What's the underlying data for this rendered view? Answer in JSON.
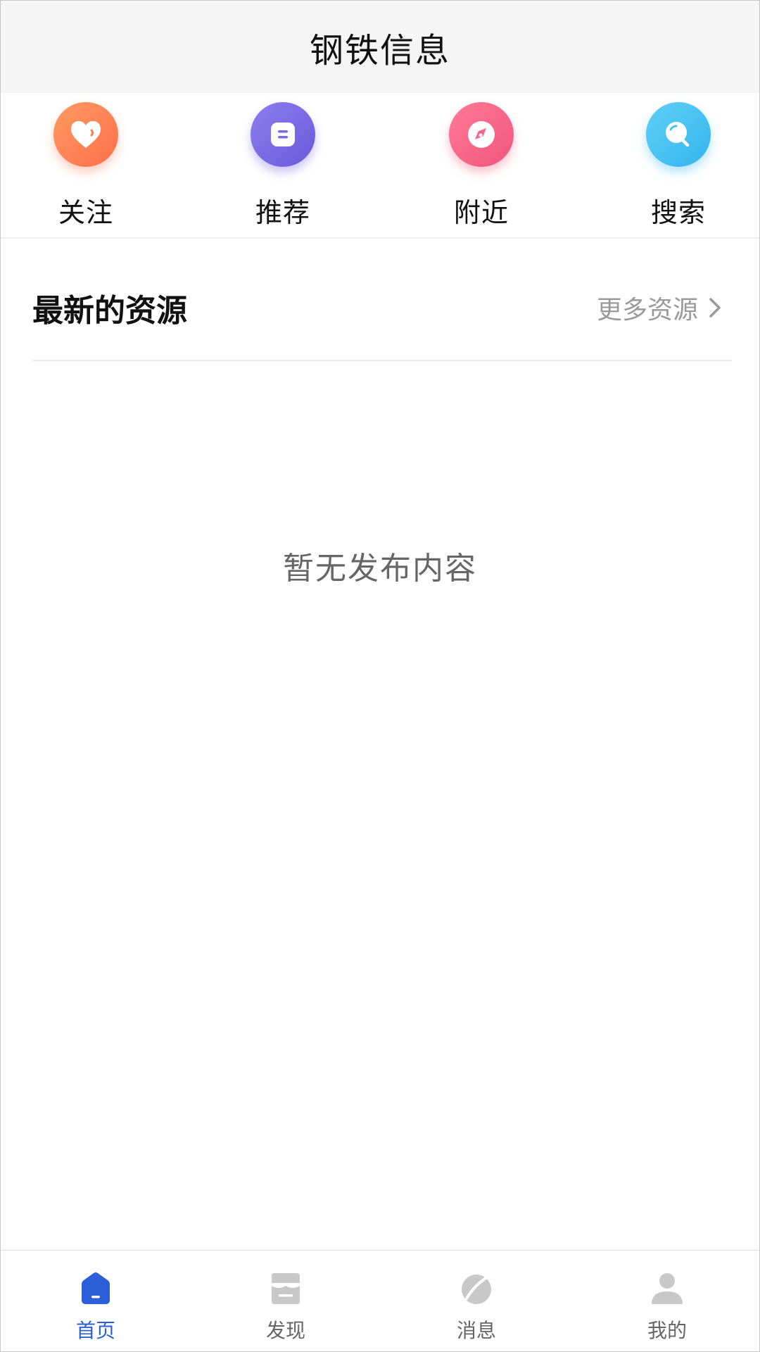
{
  "header": {
    "title": "钢铁信息"
  },
  "quick_actions": [
    {
      "label": "关注",
      "icon": "heart-icon",
      "color": "#ff7a52"
    },
    {
      "label": "推荐",
      "icon": "document-icon",
      "color": "#7b68e6"
    },
    {
      "label": "附近",
      "icon": "compass-icon",
      "color": "#f4658a"
    },
    {
      "label": "搜索",
      "icon": "search-icon",
      "color": "#40bff2"
    }
  ],
  "section": {
    "title": "最新的资源",
    "more_label": "更多资源"
  },
  "empty_state": {
    "text": "暂无发布内容"
  },
  "tabbar": {
    "active_color": "#2b5fd9",
    "inactive_color": "#c8c8c8",
    "items": [
      {
        "label": "首页",
        "icon": "home-icon",
        "active": true
      },
      {
        "label": "发现",
        "icon": "store-icon",
        "active": false
      },
      {
        "label": "消息",
        "icon": "message-icon",
        "active": false
      },
      {
        "label": "我的",
        "icon": "user-icon",
        "active": false
      }
    ]
  }
}
